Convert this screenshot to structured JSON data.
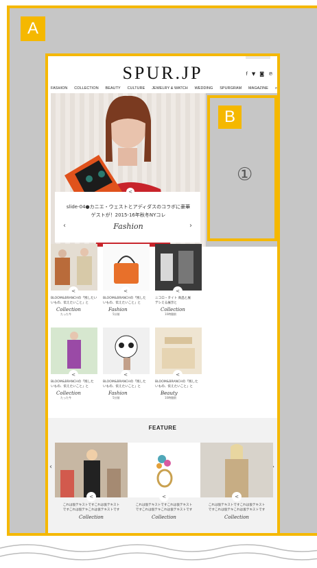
{
  "labels": {
    "a": "A",
    "b": "B",
    "slot_number": "①"
  },
  "site": {
    "logo": "SPUR.JP",
    "social_icons": [
      "f",
      "🐦",
      "◘",
      "ⓟ"
    ],
    "nav": [
      "FASHION",
      "COLLECTION",
      "BEAUTY",
      "CULTURE",
      "JEWELRY & WATCH",
      "WEDDING",
      "SPURGRAM",
      "MAGAZINE"
    ],
    "hero": {
      "caption": "slide-04●カニエ・ウェストとアディダスのコラボに豪華ゲストが！2015-16年秋冬NYコレ",
      "category": "Fashion",
      "prev": "‹",
      "next": "›"
    },
    "grid": [
      {
        "text1": "BLOOM&BRANCHの「残したい",
        "text2": "いもの、伝えたいこと」と",
        "category": "Collection",
        "date": "たった今"
      },
      {
        "text1": "BLOOM&BRANCHの「残した",
        "text2": "いもの、伝えたいこと」と",
        "category": "Fashion",
        "date": "5分前"
      },
      {
        "text1": "ニコロ・タイト 商品と展",
        "text2": "デシえる展示と",
        "category": "Collection",
        "date": "10時間前"
      },
      {
        "text1": "BLOOM&BRANCHの「残した",
        "text2": "いもの、伝えたいこと」と",
        "category": "Collection",
        "date": "たった今"
      },
      {
        "text1": "BLOOM&BRANCHの「残した",
        "text2": "いもの、伝えたいこと」と",
        "category": "Fashion",
        "date": "5分前"
      },
      {
        "text1": "BLOOM&BRANCHの「残した",
        "text2": "いもの、伝えたいこと」と",
        "category": "Beauty",
        "date": "10時間前"
      }
    ],
    "feature": {
      "title": "FEATURE",
      "items": [
        {
          "text1": "これは仮テキストですこれは仮テキスト",
          "text2": "ですこれは仮テキこれは仮テキストです",
          "category": "Collection"
        },
        {
          "text1": "これは仮テキストですこれは仮テキスト",
          "text2": "ですこれは仮テキこれは仮テキストです",
          "category": "Collection"
        },
        {
          "text1": "これは仮テキストですこれは仮テキスト",
          "text2": "ですこれは仮テキこれは仮テキストです",
          "category": "Collection"
        }
      ],
      "prev": "‹",
      "next": "›"
    }
  },
  "colors": {
    "highlight": "#f5b800",
    "placeholder": "#c6c6c6"
  }
}
